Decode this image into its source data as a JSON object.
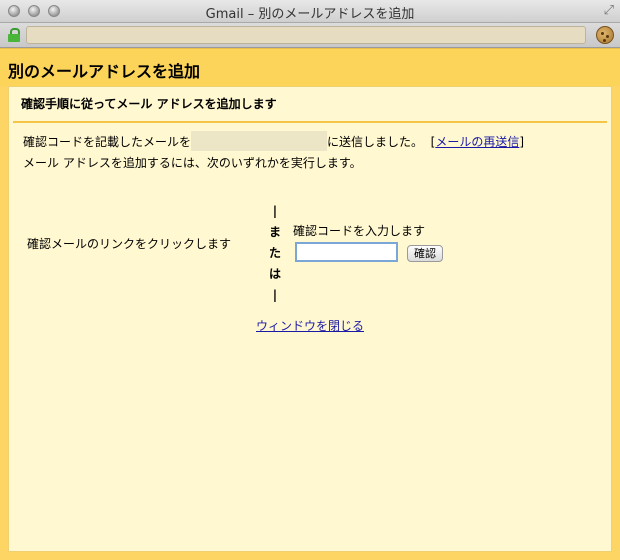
{
  "window": {
    "title": "Gmail – 別のメールアドレスを追加",
    "resize_icon": "resize-arrows-icon",
    "address_bar": {
      "url": "",
      "lock_icon": "lock-icon",
      "extension_icon": "cookie-icon"
    }
  },
  "page": {
    "heading": "別のメールアドレスを追加",
    "subheading": "確認手順に従ってメール アドレスを追加します",
    "message": {
      "prefix": "確認コードを記載したメールを",
      "redacted_email": "",
      "suffix": "に送信しました。",
      "bracket_open": "[",
      "resend_link": "メールの再送信",
      "bracket_close": "]"
    },
    "instruction": "メール アドレスを追加するには、次のいずれかを実行します。",
    "option_link_text": "確認メールのリンクをクリックします",
    "or_separator": [
      "|",
      "ま",
      "た",
      "は",
      "|"
    ],
    "option_code_text": "確認コードを入力します",
    "code_input": {
      "value": "",
      "placeholder": ""
    },
    "confirm_button": "確認",
    "close_link": "ウィンドウを閉じる"
  },
  "colors": {
    "header_bg": "#fcd45a",
    "panel_bg": "#fff8d1",
    "separator": "#f5c645",
    "link": "#1a1aa6"
  }
}
